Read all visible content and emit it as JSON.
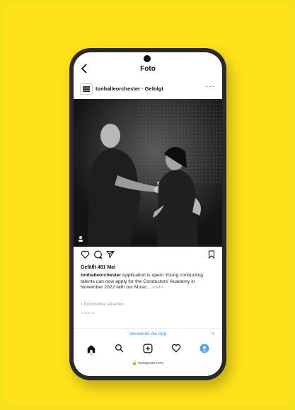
{
  "header": {
    "back_icon": "chevron-left-icon",
    "title": "Foto"
  },
  "post": {
    "username": "tonhalleorchester",
    "follow_state": "Gefolgt",
    "username_line": "tonhalleorchester · Gefolgt",
    "more_icon": "more-horizontal-icon",
    "likes": "Gefällt 481 Mal",
    "caption_user": "tonhalleorchester",
    "caption_text": " Application is open! Young conducting talents can now apply for the Conductors' Academy in November 2022 with our Music...",
    "caption_more": " mehr",
    "comments_link": "1 Kommentar ansehen",
    "date": "JUNE 28"
  },
  "banner": {
    "label": "Verwende die App",
    "close": "×"
  },
  "browser": {
    "url": "🔒 instagram.com"
  },
  "colors": {
    "background": "#ffe21a",
    "link": "#3897f0"
  }
}
